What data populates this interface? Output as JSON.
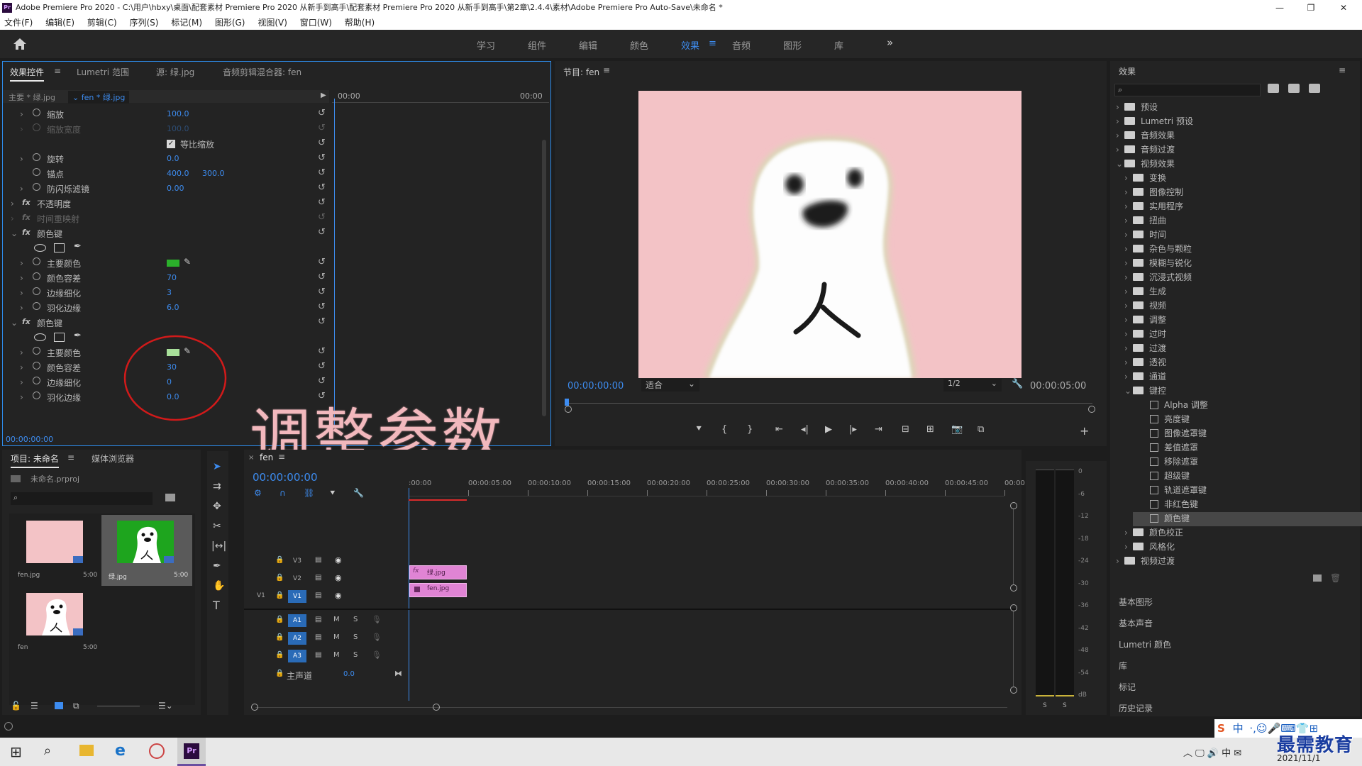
{
  "window": {
    "title": "Adobe Premiere Pro 2020 - C:\\用户\\hbxy\\桌面\\配套素材 Premiere Pro 2020 从新手到高手\\配套素材 Premiere Pro 2020 从新手到高手\\第2章\\2.4.4\\素材\\Adobe Premiere Pro Auto-Save\\未命名 *",
    "app_icon": "Pr",
    "controls": [
      "—",
      "❐",
      "✕"
    ]
  },
  "menu": [
    "文件(F)",
    "编辑(E)",
    "剪辑(C)",
    "序列(S)",
    "标记(M)",
    "图形(G)",
    "视图(V)",
    "窗口(W)",
    "帮助(H)"
  ],
  "workspaces": {
    "tabs": [
      "学习",
      "组件",
      "编辑",
      "颜色",
      "效果",
      "音频",
      "图形",
      "库"
    ],
    "active": "效果",
    "more": "»"
  },
  "effect_controls": {
    "tabs": [
      "效果控件",
      "Lumetri 范围",
      "源: 绿.jpg",
      "音频剪辑混合器: fen"
    ],
    "master_clip": "主要 * 绿.jpg",
    "sequence_clip": "fen * 绿.jpg",
    "ruler_start": "00:00",
    "ruler_end": "00:00",
    "rows": [
      {
        "type": "prop",
        "name": "缩放",
        "v1": "100.0"
      },
      {
        "type": "prop",
        "name": "缩放宽度",
        "v1": "100.0",
        "dim": true
      },
      {
        "type": "check",
        "name": "等比缩放"
      },
      {
        "type": "prop",
        "name": "旋转",
        "v1": "0.0"
      },
      {
        "type": "prop",
        "name": "锚点",
        "v1": "400.0",
        "v2": "300.0",
        "nochev": true
      },
      {
        "type": "prop",
        "name": "防闪烁滤镜",
        "v1": "0.00"
      },
      {
        "type": "fx",
        "name": "不透明度"
      },
      {
        "type": "fx",
        "name": "时间重映射",
        "dim": true
      },
      {
        "type": "fx",
        "name": "颜色键",
        "open": true
      },
      {
        "type": "masks"
      },
      {
        "type": "color",
        "name": "主要颜色",
        "color": "#2bb02b"
      },
      {
        "type": "prop",
        "name": "颜色容差",
        "v1": "70"
      },
      {
        "type": "prop",
        "name": "边缘细化",
        "v1": "3"
      },
      {
        "type": "prop",
        "name": "羽化边缘",
        "v1": "6.0"
      },
      {
        "type": "fx",
        "name": "颜色键",
        "open": true
      },
      {
        "type": "masks"
      },
      {
        "type": "color",
        "name": "主要颜色",
        "color": "#a8e09a"
      },
      {
        "type": "prop",
        "name": "颜色容差",
        "v1": "30"
      },
      {
        "type": "prop",
        "name": "边缘细化",
        "v1": "0"
      },
      {
        "type": "prop",
        "name": "羽化边缘",
        "v1": "0.0"
      }
    ],
    "timecode": "00:00:00:00"
  },
  "overlay_caption": "调整参数",
  "program_monitor": {
    "title": "节目: fen",
    "timecode": "00:00:00:00",
    "fit": "适合",
    "resolution": "1/2",
    "duration": "00:00:05:00",
    "bg_color": "#f3c3c6"
  },
  "effects_panel": {
    "title": "效果",
    "search_placeholder": "",
    "tree": [
      {
        "label": "预设",
        "level": 0,
        "kind": "folder",
        "open": false
      },
      {
        "label": "Lumetri 预设",
        "level": 0,
        "kind": "folder",
        "open": false
      },
      {
        "label": "音频效果",
        "level": 0,
        "kind": "folder",
        "open": false
      },
      {
        "label": "音频过渡",
        "level": 0,
        "kind": "folder",
        "open": false
      },
      {
        "label": "视频效果",
        "level": 0,
        "kind": "folder",
        "open": true
      },
      {
        "label": "变换",
        "level": 1,
        "kind": "folder",
        "open": false
      },
      {
        "label": "图像控制",
        "level": 1,
        "kind": "folder",
        "open": false
      },
      {
        "label": "实用程序",
        "level": 1,
        "kind": "folder",
        "open": false
      },
      {
        "label": "扭曲",
        "level": 1,
        "kind": "folder",
        "open": false
      },
      {
        "label": "时间",
        "level": 1,
        "kind": "folder",
        "open": false
      },
      {
        "label": "杂色与颗粒",
        "level": 1,
        "kind": "folder",
        "open": false
      },
      {
        "label": "模糊与锐化",
        "level": 1,
        "kind": "folder",
        "open": false
      },
      {
        "label": "沉浸式视频",
        "level": 1,
        "kind": "folder",
        "open": false
      },
      {
        "label": "生成",
        "level": 1,
        "kind": "folder",
        "open": false
      },
      {
        "label": "视频",
        "level": 1,
        "kind": "folder",
        "open": false
      },
      {
        "label": "调整",
        "level": 1,
        "kind": "folder",
        "open": false
      },
      {
        "label": "过时",
        "level": 1,
        "kind": "folder",
        "open": false
      },
      {
        "label": "过渡",
        "level": 1,
        "kind": "folder",
        "open": false
      },
      {
        "label": "透视",
        "level": 1,
        "kind": "folder",
        "open": false
      },
      {
        "label": "通道",
        "level": 1,
        "kind": "folder",
        "open": false
      },
      {
        "label": "键控",
        "level": 1,
        "kind": "folder",
        "open": true
      },
      {
        "label": "Alpha 调整",
        "level": 2,
        "kind": "preset"
      },
      {
        "label": "亮度键",
        "level": 2,
        "kind": "preset"
      },
      {
        "label": "图像遮罩键",
        "level": 2,
        "kind": "preset"
      },
      {
        "label": "差值遮罩",
        "level": 2,
        "kind": "preset"
      },
      {
        "label": "移除遮罩",
        "level": 2,
        "kind": "preset"
      },
      {
        "label": "超级键",
        "level": 2,
        "kind": "preset"
      },
      {
        "label": "轨道遮罩键",
        "level": 2,
        "kind": "preset"
      },
      {
        "label": "非红色键",
        "level": 2,
        "kind": "preset"
      },
      {
        "label": "颜色键",
        "level": 2,
        "kind": "preset",
        "selected": true
      },
      {
        "label": "颜色校正",
        "level": 1,
        "kind": "folder",
        "open": false
      },
      {
        "label": "风格化",
        "level": 1,
        "kind": "folder",
        "open": false
      },
      {
        "label": "视频过渡",
        "level": 0,
        "kind": "folder",
        "open": false
      }
    ],
    "sections": [
      "基本图形",
      "基本声音",
      "Lumetri 颜色",
      "库",
      "标记",
      "历史记录"
    ]
  },
  "project": {
    "tabs": [
      "项目: 未命名",
      "媒体浏览器"
    ],
    "file": "未命名.prproj",
    "items": [
      {
        "name": "fen.jpg",
        "duration": "5:00"
      },
      {
        "name": "绿.jpg",
        "duration": "5:00"
      },
      {
        "name": "fen",
        "duration": "5:00"
      }
    ]
  },
  "timeline": {
    "tab": "fen",
    "timecode": "00:00:00:00",
    "ruler": [
      ":00:00",
      "00:00:05:00",
      "00:00:10:00",
      "00:00:15:00",
      "00:00:20:00",
      "00:00:25:00",
      "00:00:30:00",
      "00:00:35:00",
      "00:00:40:00",
      "00:00:45:00",
      "00:00:"
    ],
    "video_tracks": [
      "V3",
      "V2",
      "V1"
    ],
    "audio_tracks": [
      "A1",
      "A2",
      "A3"
    ],
    "source_patch": "V1",
    "clips": [
      "绿.jpg",
      "fen.jpg"
    ],
    "master": {
      "label": "主声道",
      "value": "0.0"
    }
  },
  "audio_meter": {
    "scale": [
      "0",
      "-6",
      "-12",
      "-18",
      "-24",
      "-30",
      "-36",
      "-42",
      "-48",
      "-54",
      "dB"
    ],
    "solo": [
      "S",
      "S"
    ]
  },
  "taskbar": {
    "date": "2021/11/1",
    "ime": "中",
    "watermark": "最需教育"
  },
  "colors": {
    "accent": "#3d8cf0",
    "clip_pink": "#e084d4",
    "annotation_red": "#d11a1a",
    "caption_pink": "#f2b8bd"
  }
}
